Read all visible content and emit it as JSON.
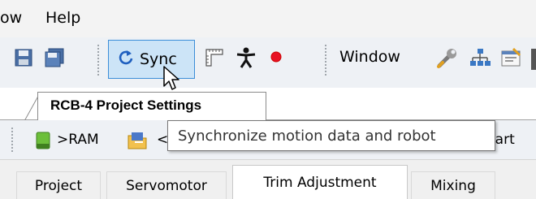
{
  "menu": {
    "items": [
      "ow",
      "Help"
    ]
  },
  "toolbar": {
    "sync_label": "Sync",
    "window_label": "Window",
    "icons": [
      "save-icon",
      "save-all-icon",
      "sync-icon",
      "ruler-icon",
      "figure-icon",
      "record-icon",
      "wrench-icon",
      "network-icon",
      "properties-icon"
    ]
  },
  "document_tab": {
    "label": "RCB-4 Project Settings"
  },
  "subbar": {
    "ram_label": ">RAM",
    "lt_label": "<",
    "start_label": "tart"
  },
  "tooltip": {
    "text": "Synchronize motion data and robot"
  },
  "tabs": [
    {
      "label": "Project",
      "active": false
    },
    {
      "label": "Servomotor",
      "active": false
    },
    {
      "label": "Trim Adjustment",
      "active": true
    },
    {
      "label": "Mixing",
      "active": false
    }
  ],
  "colors": {
    "sync_highlight": "#cce4f7",
    "sync_border": "#3c8ed8",
    "record_red": "#e81123"
  }
}
